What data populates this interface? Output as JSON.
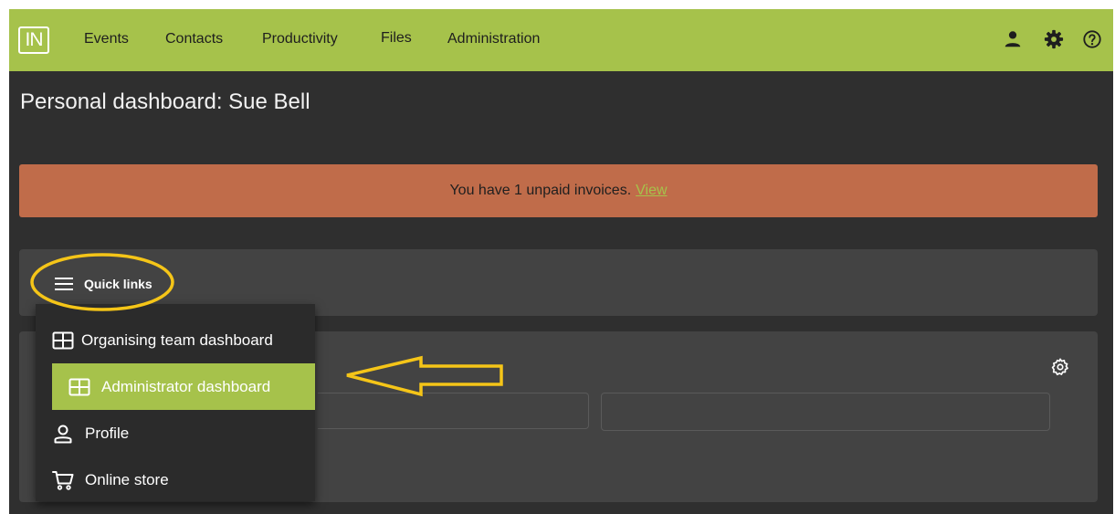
{
  "app": {
    "logo_text": "IN"
  },
  "nav": {
    "items": [
      {
        "label": "Events"
      },
      {
        "label": "Contacts"
      },
      {
        "label": "Productivity"
      },
      {
        "label": "Files"
      },
      {
        "label": "Administration"
      }
    ],
    "icons": [
      "user-icon",
      "gear-icon",
      "help-icon"
    ]
  },
  "page": {
    "title": "Personal dashboard: Sue Bell"
  },
  "alert": {
    "message": "You have 1 unpaid invoices.",
    "link_label": "View"
  },
  "quick_links": {
    "button_label": "Quick links",
    "items": [
      {
        "label": "Organising team dashboard",
        "icon": "grid-icon",
        "active": false
      },
      {
        "label": "Administrator dashboard",
        "icon": "grid-icon",
        "active": true
      },
      {
        "label": "Profile",
        "icon": "person-icon",
        "active": false
      },
      {
        "label": "Online store",
        "icon": "cart-icon",
        "active": false
      }
    ]
  },
  "colors": {
    "brand_green": "#a6c24b",
    "alert_orange": "#c06c4a",
    "background_dark": "#2f2f2f",
    "card_gray": "#434343",
    "annotation_yellow": "#f5c518"
  }
}
